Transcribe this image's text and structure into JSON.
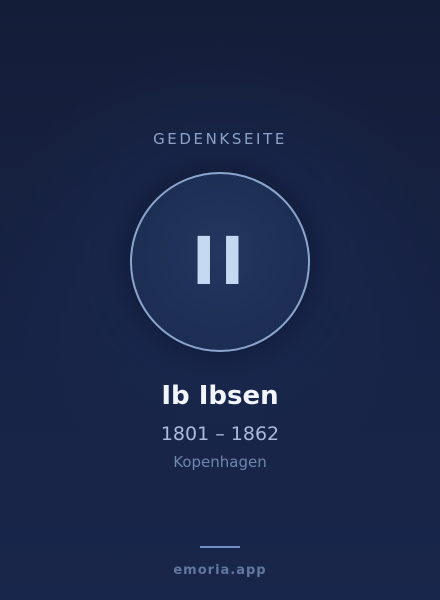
{
  "memorial": {
    "kicker": "GEDENKSEITE",
    "monogram": "II",
    "name": "Ib Ibsen",
    "dates": "1801 – 1862",
    "place": "Kopenhagen"
  },
  "footer": {
    "brand": "emoria.app"
  },
  "colors": {
    "background": "#172345",
    "accent_ring": "#8ba6cd",
    "monogram": "#c4d8f1",
    "name_text": "#f2f5fb",
    "muted_text": "#6f86ad"
  }
}
